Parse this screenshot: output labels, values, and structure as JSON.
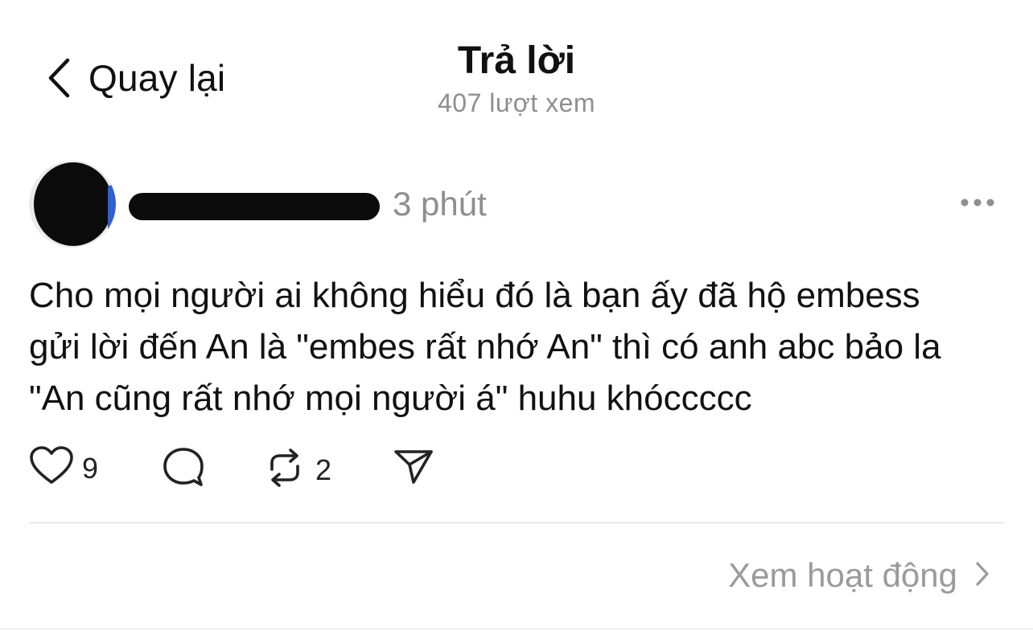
{
  "header": {
    "back_label": "Quay lại",
    "title": "Trả lời",
    "views": "407 lượt xem"
  },
  "post": {
    "timestamp": "3 phút",
    "text": "Cho mọi người ai không hiểu đó là bạn ấy đã hộ embess\ngửi lời đến An là \"embes rất nhớ An\" thì có anh abc bảo la\n\"An cũng rất nhớ mọi người á\" huhu khóccccc",
    "likes": "9",
    "reposts": "2"
  },
  "footer": {
    "activity_label": "Xem hoạt động"
  },
  "icons": {
    "back": "chevron-left-icon",
    "more": "ellipsis-icon",
    "like": "heart-icon",
    "comment": "comment-bubble-icon",
    "repost": "repost-icon",
    "share": "send-icon",
    "activity": "chevron-right-icon"
  },
  "colors": {
    "text": "#111111",
    "secondary": "#8e8e93",
    "divider": "#dcdcdc"
  }
}
